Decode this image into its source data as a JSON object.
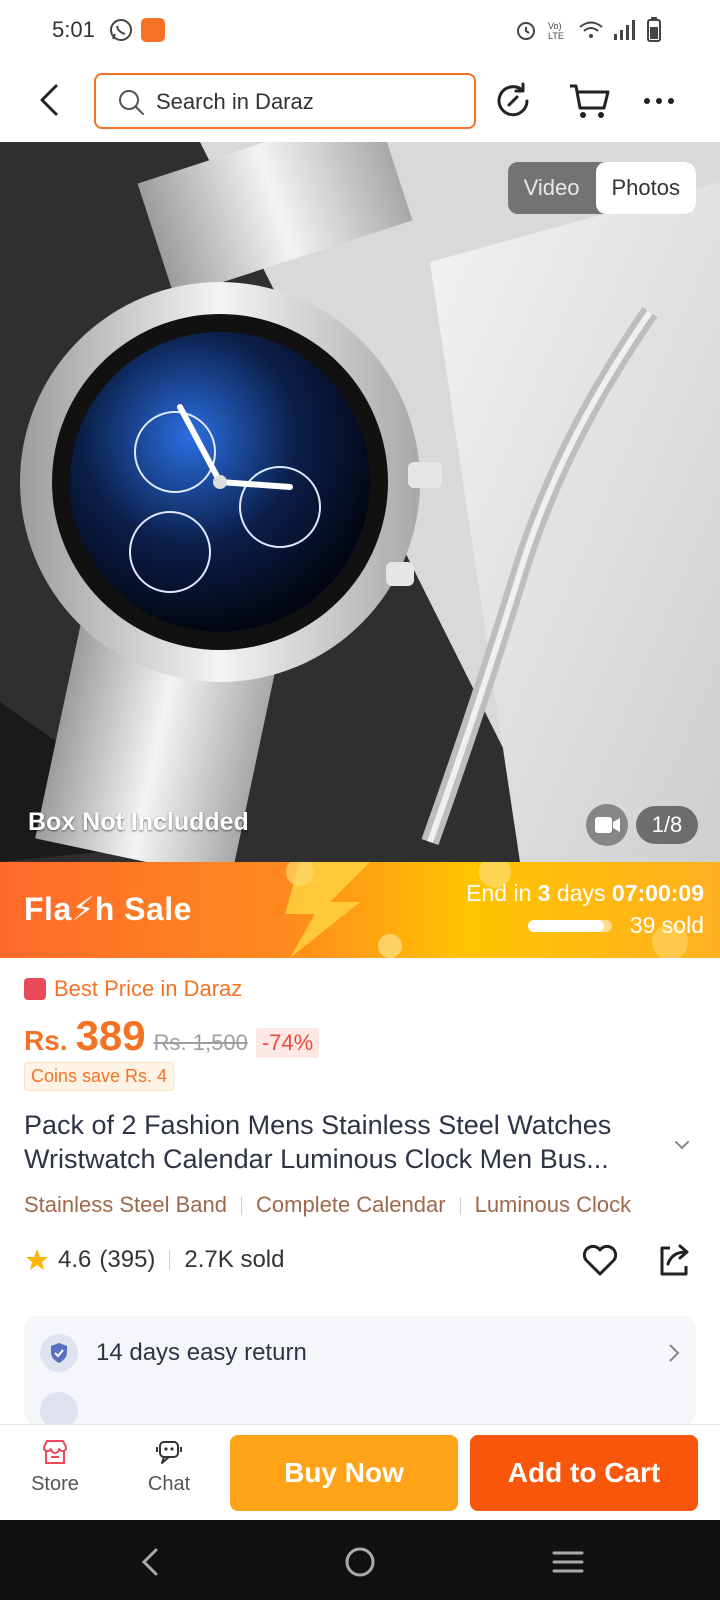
{
  "status_bar": {
    "time": "5:01"
  },
  "search": {
    "placeholder": "Search in Daraz"
  },
  "media": {
    "tabs": [
      "Video",
      "Photos"
    ],
    "active_tab": "Photos",
    "caption": "Box Not Includded",
    "counter": "1/8"
  },
  "flash_sale": {
    "title": "Fla⚡h  Sale",
    "end_prefix": "End in ",
    "end_days": "3",
    "end_mid": " days ",
    "end_time": "07:00:09",
    "sold": "39 sold",
    "sold_progress": 0.9
  },
  "price": {
    "badge": "Best Price in Daraz",
    "currency": "Rs.",
    "value": "389",
    "original": "Rs. 1,500",
    "discount": "-74%",
    "coins": "Coins save Rs. 4"
  },
  "product": {
    "title": "Pack of 2 Fashion Mens Stainless Steel Watches Wristwatch Calendar Luminous Clock Men Bus...",
    "tags": [
      "Stainless Steel Band",
      "Complete Calendar",
      "Luminous Clock"
    ],
    "rating": "4.6",
    "reviews": "(395)",
    "sold": "2.7K sold"
  },
  "services": [
    {
      "label": "14 days easy return"
    }
  ],
  "actions": {
    "store": "Store",
    "chat": "Chat",
    "buy_now": "Buy Now",
    "add_to_cart": "Add to Cart"
  },
  "colors": {
    "brand": "#f57224",
    "buy_now": "#ffa419",
    "add_to_cart": "#f8560a"
  }
}
